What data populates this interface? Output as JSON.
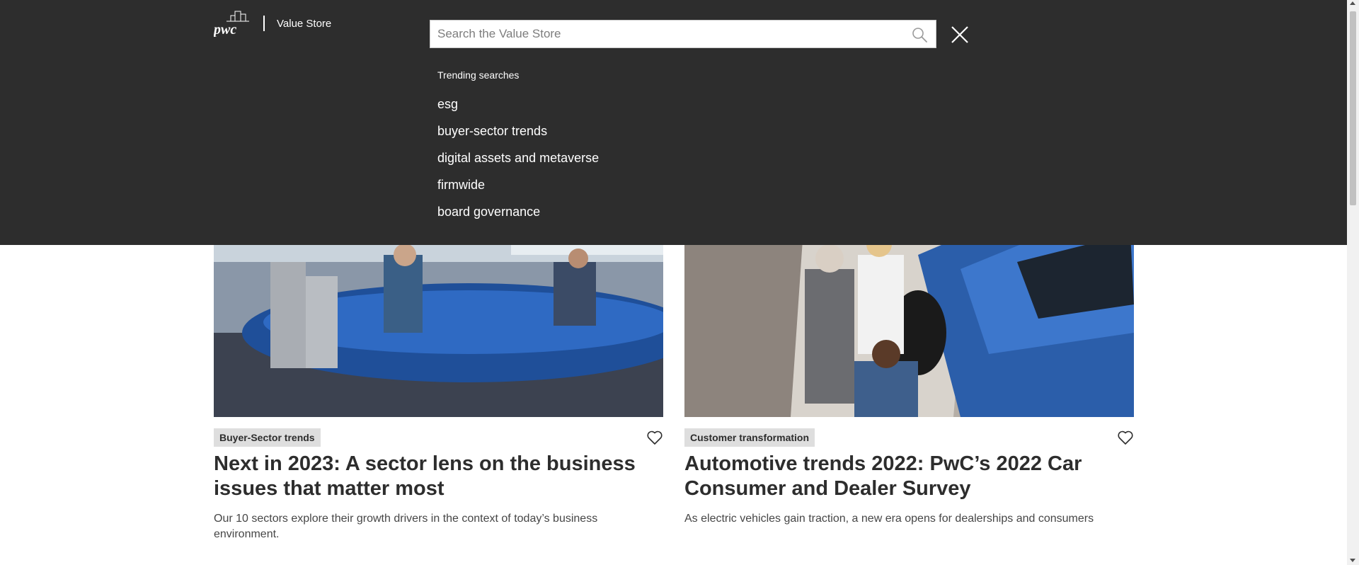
{
  "header": {
    "logo_text": "pwc",
    "store_name": "Value Store"
  },
  "search": {
    "placeholder": "Search the Value Store",
    "value": "",
    "icon": "search-icon",
    "close_icon": "close-icon"
  },
  "trending": {
    "title": "Trending searches",
    "items": [
      "esg",
      "buyer-sector trends",
      "digital assets and metaverse",
      "firmwide",
      "board governance"
    ]
  },
  "cards": [
    {
      "tag": "Buyer-Sector trends",
      "title": "Next in 2023: A sector lens on the business issues that matter most",
      "description": "Our 10 sectors explore their growth drivers in the context of today’s business environment.",
      "image": "conference-room-meeting-photo",
      "favorite_icon": "heart-icon"
    },
    {
      "tag": "Customer transformation",
      "title": "Automotive trends 2022: PwC’s 2022 Car Consumer and Dealer Survey",
      "description": "As electric vehicles gain traction, a new era opens for dealerships and consumers",
      "image": "car-dealership-photo",
      "favorite_icon": "heart-icon"
    }
  ],
  "colors": {
    "overlay_bg": "#2d2d2d",
    "text_on_dark": "#ffffff",
    "tag_bg": "#dedede",
    "title_text": "#2d2d2d"
  }
}
